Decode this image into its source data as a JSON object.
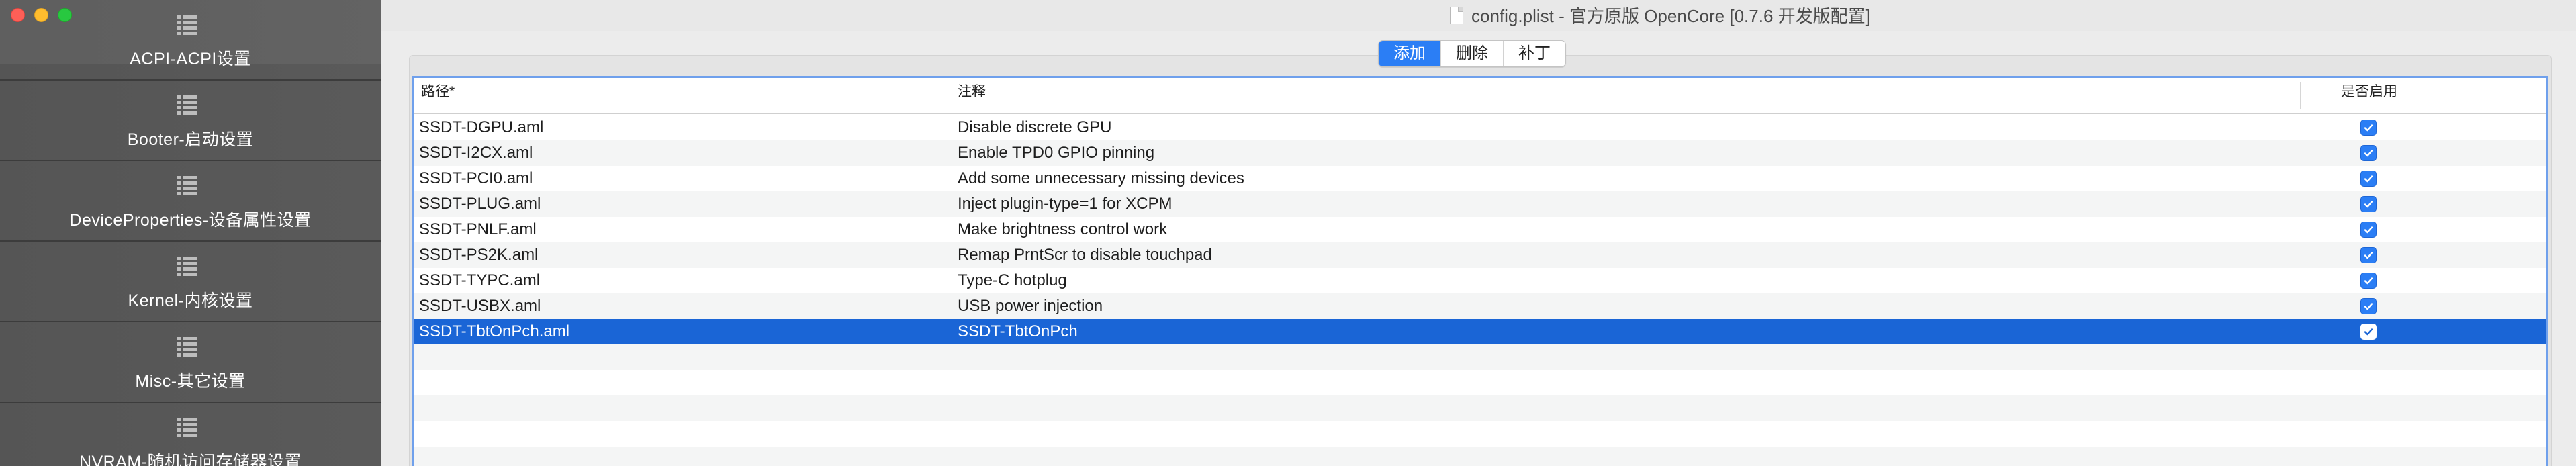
{
  "window": {
    "title": "config.plist - 官方原版 OpenCore [0.7.6 开发版配置]"
  },
  "sidebar": {
    "items": [
      {
        "label": "ACPI-ACPI设置",
        "icon": "list-icon",
        "active": true
      },
      {
        "label": "Booter-启动设置",
        "icon": "list-icon"
      },
      {
        "label": "DeviceProperties-设备属性设置",
        "icon": "list-icon"
      },
      {
        "label": "Kernel-内核设置",
        "icon": "list-icon"
      },
      {
        "label": "Misc-其它设置",
        "icon": "list-icon"
      },
      {
        "label": "NVRAM-随机访问存储器设置",
        "icon": "list-icon"
      }
    ]
  },
  "toolbar": {
    "add_label": "添加",
    "delete_label": "删除",
    "patch_label": "补丁"
  },
  "table": {
    "columns": {
      "path": "路径*",
      "comment": "注释",
      "enabled": "是否启用"
    },
    "rows": [
      {
        "path": "SSDT-DGPU.aml",
        "comment": "Disable discrete GPU",
        "enabled": true
      },
      {
        "path": "SSDT-I2CX.aml",
        "comment": "Enable TPD0 GPIO pinning",
        "enabled": true
      },
      {
        "path": "SSDT-PCI0.aml",
        "comment": "Add some unnecessary missing devices",
        "enabled": true
      },
      {
        "path": "SSDT-PLUG.aml",
        "comment": "Inject plugin-type=1 for XCPM",
        "enabled": true
      },
      {
        "path": "SSDT-PNLF.aml",
        "comment": "Make brightness control work",
        "enabled": true
      },
      {
        "path": "SSDT-PS2K.aml",
        "comment": "Remap PrntScr to disable touchpad",
        "enabled": true
      },
      {
        "path": "SSDT-TYPC.aml",
        "comment": "Type-C hotplug",
        "enabled": true
      },
      {
        "path": "SSDT-USBX.aml",
        "comment": "USB power injection",
        "enabled": true
      },
      {
        "path": "SSDT-TbtOnPch.aml",
        "comment": "SSDT-TbtOnPch",
        "enabled": true,
        "selected": true
      }
    ]
  },
  "colors": {
    "accent": "#2b7ef5",
    "selection": "#1a65d6",
    "sidebar_bg": "#585858"
  }
}
